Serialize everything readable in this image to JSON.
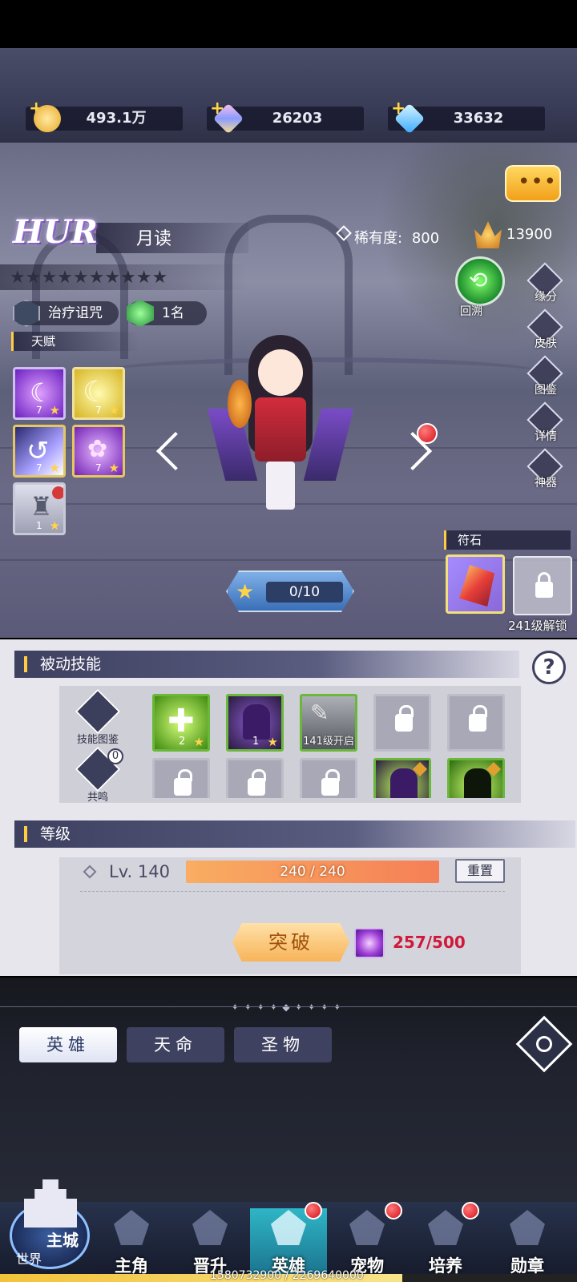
{
  "currency": {
    "gold": "493.1万",
    "gem_pink": "26203",
    "gem_blue": "33632"
  },
  "hero": {
    "grade": "HUR",
    "name": "月读",
    "rarity_label": "稀有度:",
    "rarity_value": "800",
    "power": "13900",
    "star_count": 10,
    "role_tag": "治疗诅咒",
    "rank_tag": "1名",
    "huisu_label": "回溯"
  },
  "talent": {
    "header": "天赋",
    "items": [
      {
        "level": "7"
      },
      {
        "level": "7"
      },
      {
        "level": "7"
      },
      {
        "level": "7"
      },
      {
        "level": "1"
      }
    ]
  },
  "side_buttons": [
    "缘分",
    "皮肤",
    "图鉴",
    "详情",
    "神器"
  ],
  "rune": {
    "header": "符石",
    "unlock_text": "241级解锁"
  },
  "upgrade_progress": "0/10",
  "passive": {
    "header": "被动技能",
    "help": "?",
    "codex_label": "技能图鉴",
    "resonance_label": "共鸣",
    "resonance_count": "0",
    "slots": [
      {
        "label": "2"
      },
      {
        "label": "1"
      },
      {
        "label": "141级开启"
      }
    ]
  },
  "level": {
    "header": "等级",
    "label": "Lv. 140",
    "xp": "240 / 240",
    "reset": "重置",
    "break_button": "突破",
    "orb_count": "257/500"
  },
  "tabs": [
    "英雄",
    "天命",
    "圣物"
  ],
  "nav": {
    "city": "主城",
    "world": "世界",
    "items": [
      "主角",
      "晋升",
      "英雄",
      "宠物",
      "培养",
      "勋章"
    ]
  },
  "account_xp": "1580732900 / 2269640000",
  "colors": {
    "accent_gold": "#ffcc44",
    "badge_red": "#d4121a",
    "active_tab_teal": "#2fb6c6"
  }
}
